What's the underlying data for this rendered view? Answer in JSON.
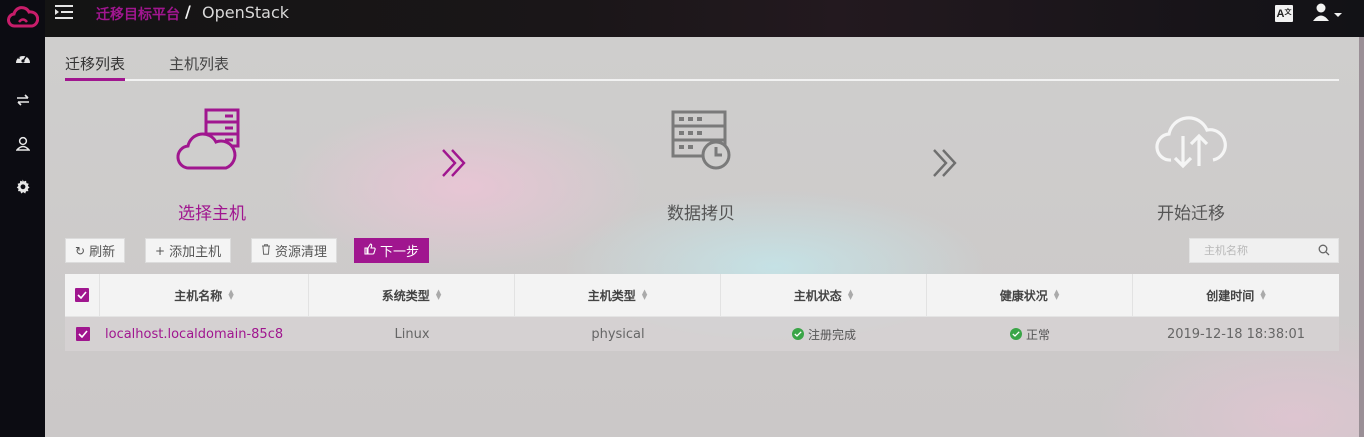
{
  "header": {
    "platform": "迁移目标平台",
    "separator": "/",
    "current": "OpenStack",
    "lang_label": "A"
  },
  "sidebar": {
    "icons": [
      "cloud-logo-icon",
      "dashboard-icon",
      "transfer-icon",
      "user-icon",
      "gear-icon"
    ]
  },
  "tabs": [
    {
      "label": "迁移列表",
      "active": true
    },
    {
      "label": "主机列表",
      "active": false
    }
  ],
  "steps": [
    {
      "label": "选择主机",
      "icon": "cloud-server-icon",
      "active": true
    },
    {
      "label": "数据拷贝",
      "icon": "server-clock-icon",
      "active": false
    },
    {
      "label": "开始迁移",
      "icon": "cloud-sync-icon",
      "active": false
    }
  ],
  "toolbar": {
    "refresh": "刷新",
    "add_host": "添加主机",
    "cleanup": "资源清理",
    "next": "下一步"
  },
  "search": {
    "placeholder": "主机名称"
  },
  "table": {
    "headers": [
      "主机名称",
      "系统类型",
      "主机类型",
      "主机状态",
      "健康状况",
      "创建时间"
    ],
    "rows": [
      {
        "name": "localhost.localdomain-85c8",
        "os": "Linux",
        "type": "physical",
        "status": "注册完成",
        "health": "正常",
        "created": "2019-12-18 18:38:01",
        "checked": true
      }
    ]
  },
  "colors": {
    "accent": "#a0168f",
    "ok": "#3aa547"
  }
}
